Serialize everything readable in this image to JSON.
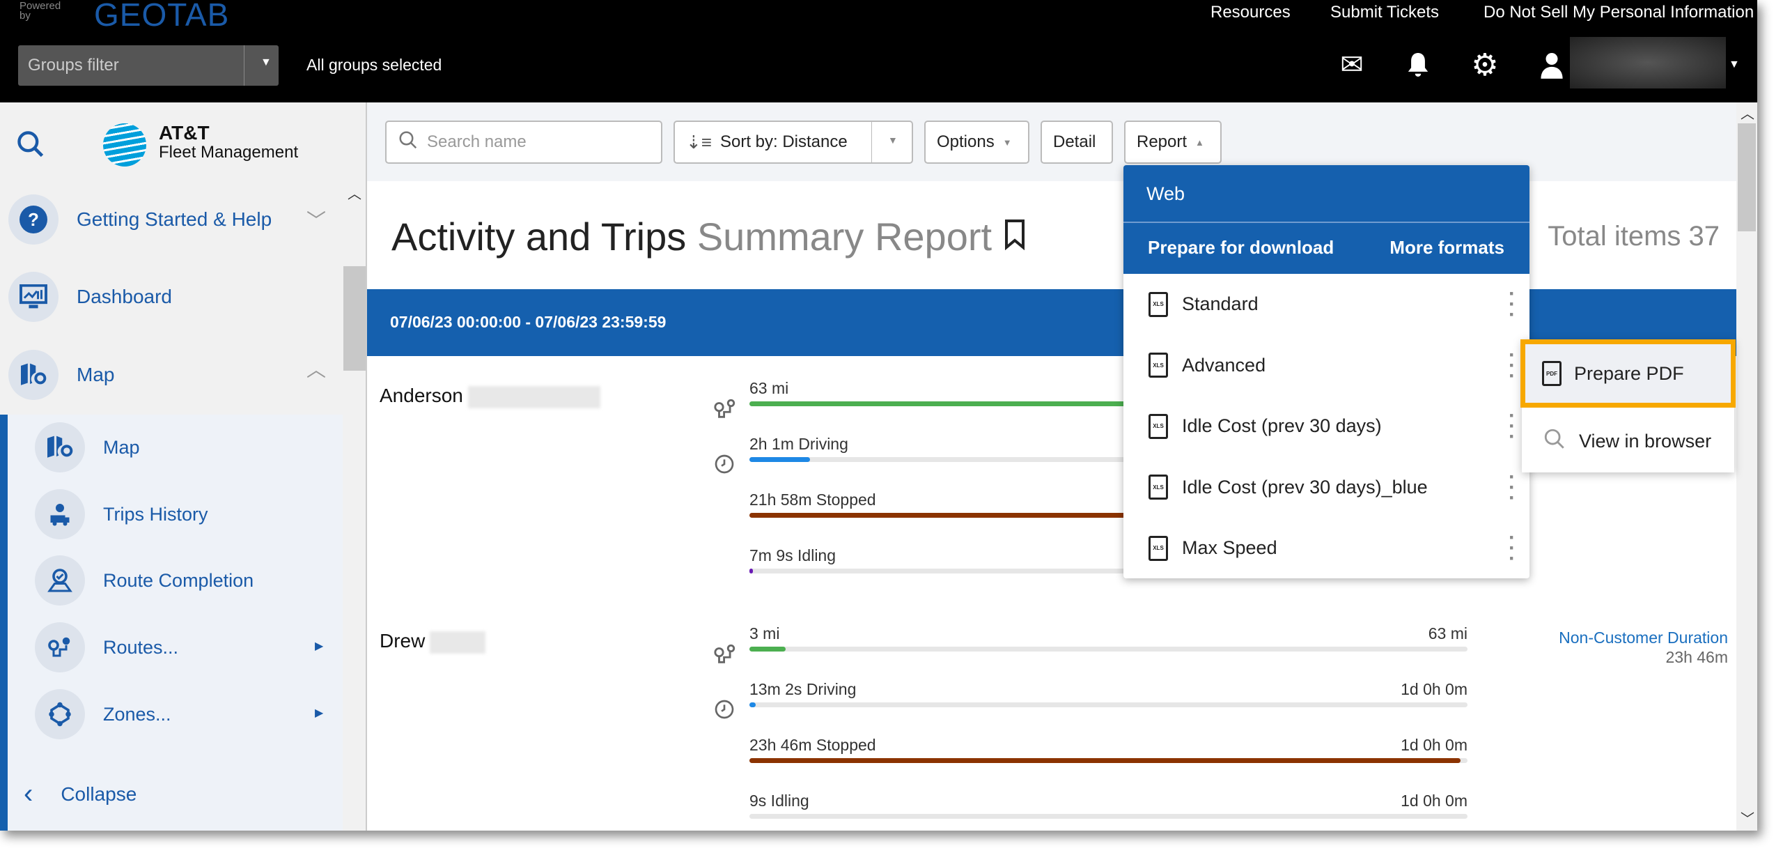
{
  "topbar": {
    "powered_by": "Powered by",
    "brand": "GEOTAB",
    "groups_filter_placeholder": "Groups filter",
    "groups_status": "All groups selected",
    "links": [
      "Resources",
      "Submit Tickets",
      "Do Not Sell My Personal Information"
    ]
  },
  "sidebar": {
    "logo_line1": "AT&T",
    "logo_line2": "Fleet Management",
    "items": [
      {
        "label": "Getting Started & Help",
        "icon": "help-icon"
      },
      {
        "label": "Dashboard",
        "icon": "dashboard-icon"
      },
      {
        "label": "Map",
        "icon": "map-icon"
      }
    ],
    "subitems": [
      {
        "label": "Map",
        "icon": "map-icon"
      },
      {
        "label": "Trips History",
        "icon": "trips-history-icon"
      },
      {
        "label": "Route Completion",
        "icon": "route-completion-icon"
      },
      {
        "label": "Routes...",
        "icon": "routes-icon"
      },
      {
        "label": "Zones...",
        "icon": "zones-icon"
      }
    ],
    "collapse": "Collapse"
  },
  "toolbar": {
    "search_placeholder": "Search name",
    "sort_prefix": "Sort by:",
    "sort_value": "Distance",
    "options": "Options",
    "detail": "Detail",
    "report": "Report"
  },
  "page": {
    "title_main": "Activity and Trips",
    "title_sub": "Summary Report",
    "total_items": "Total items 37",
    "date_range": "07/06/23 00:00:00 - 07/06/23 23:59:59"
  },
  "drivers": [
    {
      "name": "Anderson",
      "rows": [
        {
          "label": "63 mi",
          "max": "",
          "fraction": 1.0,
          "color": "#4caf50",
          "icon": "route-icon"
        },
        {
          "label": "2h 1m Driving",
          "max": "",
          "fraction": 0.084,
          "color": "#1e88e5",
          "icon": "clock-icon"
        },
        {
          "label": "21h 58m Stopped",
          "max": "",
          "fraction": 0.915,
          "color": "#8b3300",
          "icon": ""
        },
        {
          "label": "7m 9s Idling",
          "max": "",
          "fraction": 0.005,
          "color": "#6a1bb5",
          "icon": ""
        }
      ]
    },
    {
      "name": "Drew",
      "extra_label": "Non-Customer Duration",
      "extra_value": "23h 46m",
      "rows": [
        {
          "label": "3 mi",
          "max": "63 mi",
          "fraction": 0.05,
          "color": "#4caf50",
          "icon": "route-icon"
        },
        {
          "label": "13m 2s Driving",
          "max": "1d 0h 0m",
          "fraction": 0.009,
          "color": "#1e88e5",
          "icon": "clock-icon"
        },
        {
          "label": "23h 46m Stopped",
          "max": "1d 0h 0m",
          "fraction": 0.99,
          "color": "#8b3300",
          "icon": ""
        },
        {
          "label": "9s Idling",
          "max": "1d 0h 0m",
          "fraction": 0.0,
          "color": "#6a1bb5",
          "icon": ""
        }
      ]
    }
  ],
  "report_menu": {
    "header": "Web",
    "prepare": "Prepare for download",
    "more": "More formats",
    "items": [
      "Standard",
      "Advanced",
      "Idle Cost (prev 30 days)",
      "Idle Cost (prev 30 days)_blue",
      "Max Speed"
    ],
    "submenu": {
      "prepare_pdf": "Prepare PDF",
      "view_browser": "View in browser"
    }
  },
  "colors": {
    "brand_blue": "#1560ae",
    "highlight": "#f7a800"
  }
}
